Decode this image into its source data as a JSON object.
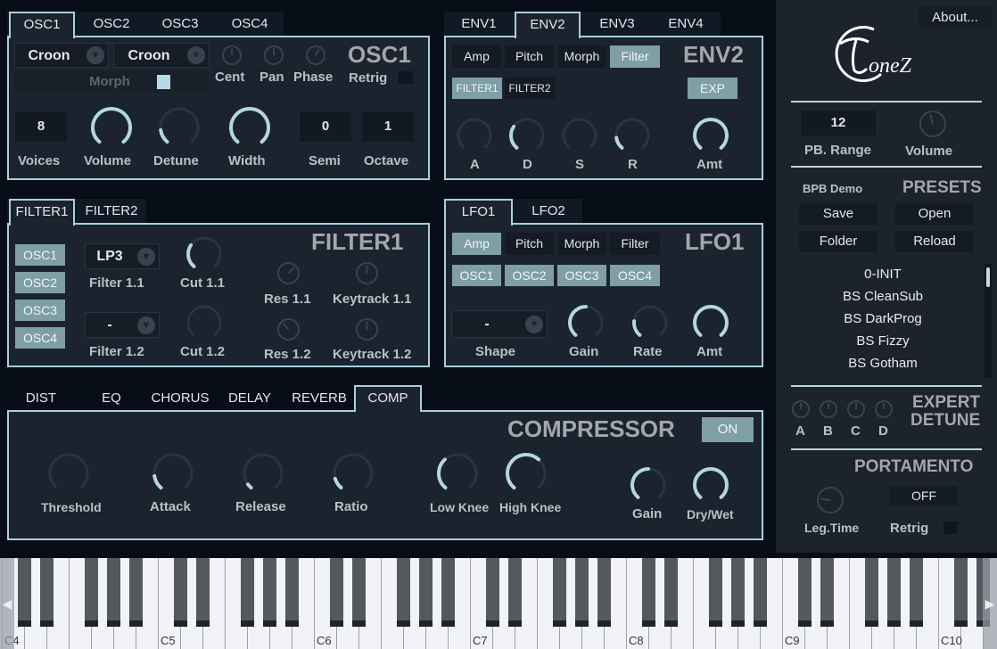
{
  "colors": {
    "accent": "#a6d0dc",
    "active_button": "#7f9ea6",
    "panel": "#1b232e",
    "background": "#070d17",
    "sidebar": "#1c232c"
  },
  "osc": {
    "tabs": [
      "OSC1",
      "OSC2",
      "OSC3",
      "OSC4"
    ],
    "active_tab": "OSC1",
    "title": "OSC1",
    "wave1": "Croon",
    "wave2": "Croon",
    "morph_label": "Morph",
    "morph_checked": true,
    "cent": {
      "label": "Cent",
      "value": 0.5
    },
    "pan": {
      "label": "Pan",
      "value": 0.5
    },
    "phase": {
      "label": "Phase",
      "value": 0.6
    },
    "retrig_label": "Retrig",
    "retrig_checked": false,
    "voices": {
      "label": "Voices",
      "value": "8"
    },
    "volume": {
      "label": "Volume",
      "value": 1.0
    },
    "detune": {
      "label": "Detune",
      "value": 0.15
    },
    "width": {
      "label": "Width",
      "value": 1.0
    },
    "semi": {
      "label": "Semi",
      "value": "0"
    },
    "octave": {
      "label": "Octave",
      "value": "1"
    }
  },
  "env": {
    "tabs": [
      "ENV1",
      "ENV2",
      "ENV3",
      "ENV4"
    ],
    "active_tab": "ENV2",
    "title": "ENV2",
    "targets": [
      "Amp",
      "Pitch",
      "Morph",
      "Filter"
    ],
    "active_target": "Filter",
    "filters": [
      "FILTER1",
      "FILTER2"
    ],
    "active_filter": "FILTER1",
    "exp_label": "EXP",
    "a": {
      "label": "A",
      "value": 0.0
    },
    "d": {
      "label": "D",
      "value": 0.3
    },
    "s": {
      "label": "S",
      "value": 0.0
    },
    "r": {
      "label": "R",
      "value": 0.15
    },
    "amt": {
      "label": "Amt",
      "value": 1.0
    }
  },
  "filter": {
    "tabs": [
      "FILTER1",
      "FILTER2"
    ],
    "active_tab": "FILTER1",
    "title": "FILTER1",
    "oscs": [
      "OSC1",
      "OSC2",
      "OSC3",
      "OSC4"
    ],
    "type1": {
      "label": "Filter 1.1",
      "value": "LP3"
    },
    "type2": {
      "label": "Filter 1.2",
      "value": "-"
    },
    "cut1": {
      "label": "Cut 1.1",
      "value": 0.3
    },
    "cut2": {
      "label": "Cut 1.2",
      "value": 0.0
    },
    "res1": {
      "label": "Res 1.1",
      "value": 0.65
    },
    "res2": {
      "label": "Res 1.2",
      "value": 0.35
    },
    "key1": {
      "label": "Keytrack 1.1",
      "value": 0.5
    },
    "key2": {
      "label": "Keytrack 1.2",
      "value": 0.5
    }
  },
  "lfo": {
    "tabs": [
      "LFO1",
      "LFO2"
    ],
    "active_tab": "LFO1",
    "title": "LFO1",
    "targets": [
      "Amp",
      "Pitch",
      "Morph",
      "Filter"
    ],
    "active_target": "Amp",
    "oscs": [
      "OSC1",
      "OSC2",
      "OSC3",
      "OSC4"
    ],
    "shape": {
      "label": "Shape",
      "value": "-"
    },
    "gain": {
      "label": "Gain",
      "value": 0.5
    },
    "rate": {
      "label": "Rate",
      "value": 0.2
    },
    "amt": {
      "label": "Amt",
      "value": 1.0
    }
  },
  "fx": {
    "tabs": [
      "DIST",
      "EQ",
      "CHORUS",
      "DELAY",
      "REVERB",
      "COMP"
    ],
    "active_tab": "COMP",
    "title": "COMPRESSOR",
    "on_label": "ON",
    "threshold": {
      "label": "Threshold",
      "value": 0.0
    },
    "attack": {
      "label": "Attack",
      "value": 0.15
    },
    "release": {
      "label": "Release",
      "value": 0.05
    },
    "ratio": {
      "label": "Ratio",
      "value": 0.12
    },
    "low_knee": {
      "label": "Low Knee",
      "value": 0.35
    },
    "high_knee": {
      "label": "High Knee",
      "value": 0.65
    },
    "gain": {
      "label": "Gain",
      "value": 0.5
    },
    "dry_wet": {
      "label": "Dry/Wet",
      "value": 1.0
    }
  },
  "sidebar": {
    "about": "About...",
    "logo_text": "ToneZ",
    "pb_range": {
      "label": "PB. Range",
      "value": "12"
    },
    "volume": {
      "label": "Volume",
      "value": 0.45
    },
    "preset_name": "BPB Demo",
    "presets_title": "PRESETS",
    "save": "Save",
    "open": "Open",
    "folder": "Folder",
    "reload": "Reload",
    "presets": [
      "0-INIT",
      "BS CleanSub",
      "BS DarkProg",
      "BS Fizzy",
      "BS Gotham"
    ],
    "expert_title_1": "EXPERT",
    "expert_title_2": "DETUNE",
    "detune": [
      {
        "label": "A",
        "value": 0.5
      },
      {
        "label": "B",
        "value": 0.5
      },
      {
        "label": "C",
        "value": 0.5
      },
      {
        "label": "D",
        "value": 0.5
      }
    ],
    "portamento_title": "PORTAMENTO",
    "portamento_state": "OFF",
    "leg_time": {
      "label": "Leg.Time",
      "value": 0.2
    },
    "retrig_label": "Retrig"
  },
  "keyboard": {
    "octave_labels": [
      "C4",
      "C5",
      "C6",
      "C7",
      "C8",
      "C9",
      "C10"
    ]
  }
}
